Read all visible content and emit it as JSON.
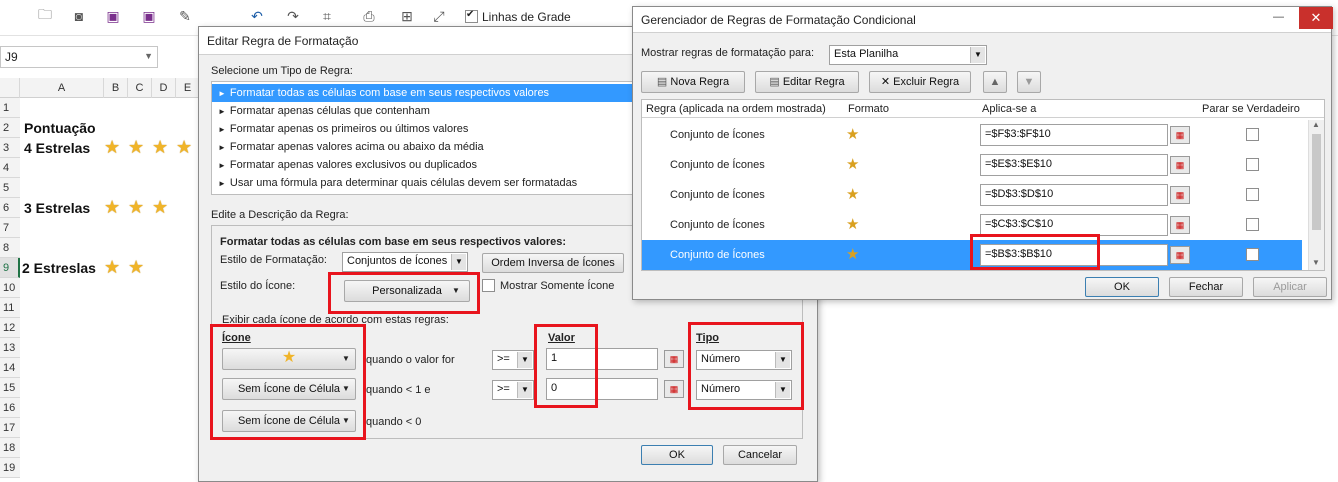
{
  "excel": {
    "qat": {
      "gridlines_label": "Linhas de Grade",
      "qat_icons": [
        "folder-icon",
        "camera-icon",
        "save-icon",
        "save-as-icon",
        "spell-icon",
        "undo-icon",
        "redo-icon",
        "format-painter-icon",
        "print-preview-icon",
        "fullscreen-icon",
        "checkbox-icon"
      ]
    },
    "name_box": "J9",
    "columns": [
      "A",
      "B",
      "C",
      "D",
      "E"
    ],
    "rows": [
      "1",
      "2",
      "3",
      "4",
      "5",
      "6",
      "7",
      "8",
      "9",
      "10",
      "11",
      "12",
      "13",
      "14",
      "15",
      "16",
      "17",
      "18",
      "19"
    ],
    "cells": {
      "pontuacao": "Pontuação",
      "four": "4 Estrelas",
      "three": "3 Estrelas",
      "two": "2 Estreslas"
    },
    "star_glyph": "★"
  },
  "edit_dialog": {
    "title": "Editar Regra de Formatação",
    "select_type_label": "Selecione um Tipo de Regra:",
    "rule_types": [
      "Formatar todas as células com base em seus respectivos valores",
      "Formatar apenas células que contenham",
      "Formatar apenas os primeiros ou últimos valores",
      "Formatar apenas valores acima ou abaixo da média",
      "Formatar apenas valores exclusivos ou duplicados",
      "Usar uma fórmula para determinar quais células devem ser formatadas"
    ],
    "rule_arrow": "►",
    "edit_desc_label": "Edite a Descrição da Regra:",
    "desc_heading": "Formatar todas as células com base em seus respectivos valores:",
    "format_style_label": "Estilo de Formatação:",
    "format_style_value": "Conjuntos de Ícones",
    "reverse_order_button": "Ordem Inversa de Ícones",
    "icon_style_label": "Estilo do Ícone:",
    "icon_style_value": "Personalizada",
    "show_icon_only_label": "Mostrar Somente Ícone",
    "display_rules_label": "Exibir cada ícone de acordo com estas regras:",
    "icon_col": "Ícone",
    "value_col": "Valor",
    "type_col": "Tipo",
    "rules": [
      {
        "icon": "★",
        "condition": "quando o valor for",
        "op": ">=",
        "value": "1",
        "type": "Número"
      },
      {
        "icon": "Sem Ícone de Célula",
        "condition": "quando < 1 e",
        "op": ">=",
        "value": "0",
        "type": "Número"
      },
      {
        "icon": "Sem Ícone de Célula",
        "condition": "quando < 0"
      }
    ],
    "ok": "OK",
    "cancel": "Cancelar"
  },
  "manager_dialog": {
    "title": "Gerenciador de Regras de Formatação Condicional",
    "show_rules_label": "Mostrar regras de formatação para:",
    "show_rules_value": "Esta Planilha",
    "new_rule": "Nova Regra",
    "edit_rule": "Editar Regra",
    "delete_rule": "Excluir Regra",
    "headers": {
      "rule": "Regra (aplicada na ordem mostrada)",
      "format": "Formato",
      "applies": "Aplica-se a",
      "stop": "Parar se Verdadeiro"
    },
    "rows": [
      {
        "rule": "Conjunto de Ícones",
        "format": "★",
        "applies": "=$F$3:$F$10"
      },
      {
        "rule": "Conjunto de Ícones",
        "format": "★",
        "applies": "=$E$3:$E$10"
      },
      {
        "rule": "Conjunto de Ícones",
        "format": "★",
        "applies": "=$D$3:$D$10"
      },
      {
        "rule": "Conjunto de Ícones",
        "format": "★",
        "applies": "=$C$3:$C$10"
      },
      {
        "rule": "Conjunto de Ícones",
        "format": "★",
        "applies": "=$B$3:$B$10"
      }
    ],
    "ok": "OK",
    "close": "Fechar",
    "apply": "Aplicar",
    "win_min": "—",
    "win_close": "✕"
  }
}
